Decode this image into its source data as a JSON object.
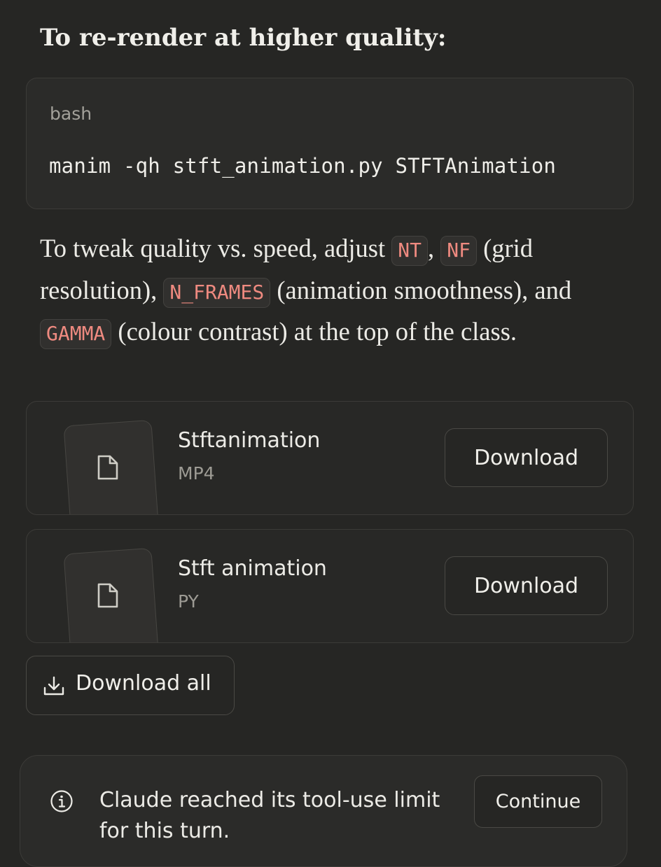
{
  "heading": "To re-render at higher quality:",
  "code_block": {
    "language": "bash",
    "command": "manim -qh stft_animation.py STFTAnimation"
  },
  "paragraph": {
    "t1": "To tweak quality vs. speed, adjust ",
    "c1": "NT",
    "t2": ", ",
    "c2": "NF",
    "t3": " (grid resolution), ",
    "c3": "N_FRAMES",
    "t4": " (animation smoothness), and ",
    "c4": "GAMMA",
    "t5": " (colour contrast) at the top of the class."
  },
  "files": [
    {
      "name": "Stftanimation",
      "type": "MP4",
      "button_label": "Download",
      "icon": "document-icon"
    },
    {
      "name": "Stft animation",
      "type": "PY",
      "button_label": "Download",
      "icon": "document-icon"
    }
  ],
  "download_all": {
    "label": "Download all",
    "icon": "download-icon"
  },
  "notice": {
    "icon": "info-icon",
    "text": "Claude reached its tool-use limit for this turn.",
    "button_label": "Continue"
  },
  "colors": {
    "background": "#262624",
    "inline_code_text": "#ef8a80",
    "card_border": "#3c3b38"
  }
}
